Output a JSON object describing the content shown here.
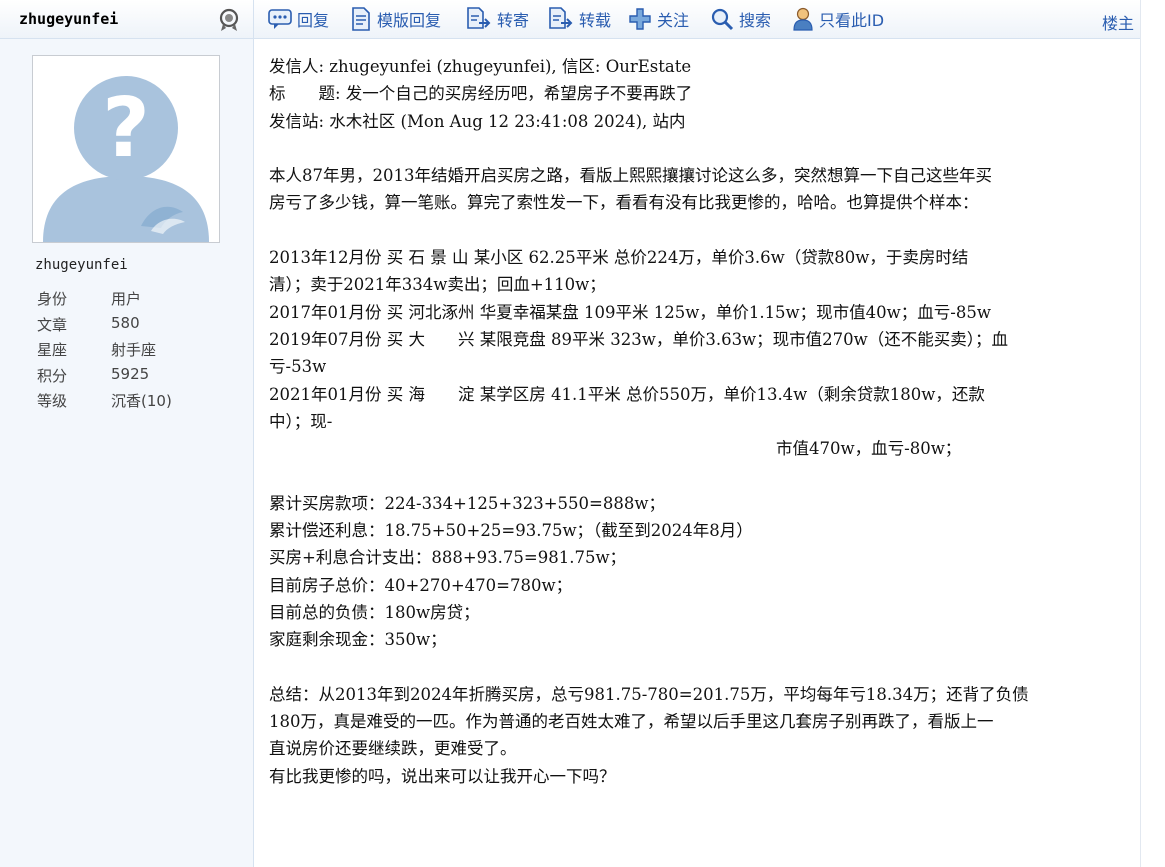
{
  "left_panel": {
    "header_username": "zhugeyunfei",
    "avatar_alt": "default avatar",
    "username": "zhugeyunfei",
    "info": [
      {
        "key": "身份",
        "value": "用户"
      },
      {
        "key": "文章",
        "value": "580"
      },
      {
        "key": "星座",
        "value": "射手座"
      },
      {
        "key": "积分",
        "value": "5925"
      },
      {
        "key": "等级",
        "value": "沉香(10)"
      }
    ]
  },
  "toolbar": {
    "reply": "回复",
    "template_reply": "模版回复",
    "forward": "转寄",
    "repost": "转载",
    "follow": "关注",
    "search": "搜索",
    "only_author": "只看此ID",
    "floor": "楼主"
  },
  "post": {
    "lines": [
      "发信人: zhugeyunfei (zhugeyunfei), 信区: OurEstate",
      "标　　题: 发一个自己的买房经历吧，希望房子不要再跌了",
      "发信站: 水木社区 (Mon Aug 12 23:41:08 2024), 站内",
      "",
      "本人87年男，2013年结婚开启买房之路，看版上熙熙攘攘讨论这么多，突然想算一下自己这些年买",
      "房亏了多少钱，算一笔账。算完了索性发一下，看看有没有比我更惨的，哈哈。也算提供个样本：",
      "",
      "2013年12月份 买 石 景 山 某小区 62.25平米 总价224万，单价3.6w（贷款80w，于卖房时结",
      "清）；卖于2021年334w卖出；回血+110w；",
      "2017年01月份 买 河北涿州 华夏幸福某盘 109平米 125w，单价1.15w；现市值40w；血亏-85w",
      "2019年07月份 买 大　　兴 某限竞盘 89平米 323w，单价3.63w；现市值270w（还不能买卖）；血",
      "亏-53w",
      "2021年01月份 买 海　　淀 某学区房 41.1平米 总价550万，单价13.4w（剩余贷款180w，还款",
      "中）；现-",
      "市值470w，血亏-80w；",
      "",
      "累计买房款项：224-334+125+323+550=888w；",
      "累计偿还利息：18.75+50+25=93.75w；（截至到2024年8月）",
      "买房+利息合计支出：888+93.75=981.75w；",
      "目前房子总价：40+270+470=780w；",
      "目前总的负债：180w房贷；",
      "家庭剩余现金：350w；",
      "",
      "总结：从2013年到2024年折腾买房，总亏981.75-780=201.75万，平均每年亏18.34万；还背了负债",
      "180万，真是难受的一匹。作为普通的老百姓太难了，希望以后手里这几套房子别再跌了，看版上一",
      "直说房价还要继续跌，更难受了。",
      "有比我更惨的吗，说出来可以让我开心一下吗？",
      "",
      "",
      "",
      "--"
    ]
  },
  "colors": {
    "link": "#2a5db0",
    "panel_bg": "#f3f7fc",
    "border": "#d6e2f0"
  }
}
